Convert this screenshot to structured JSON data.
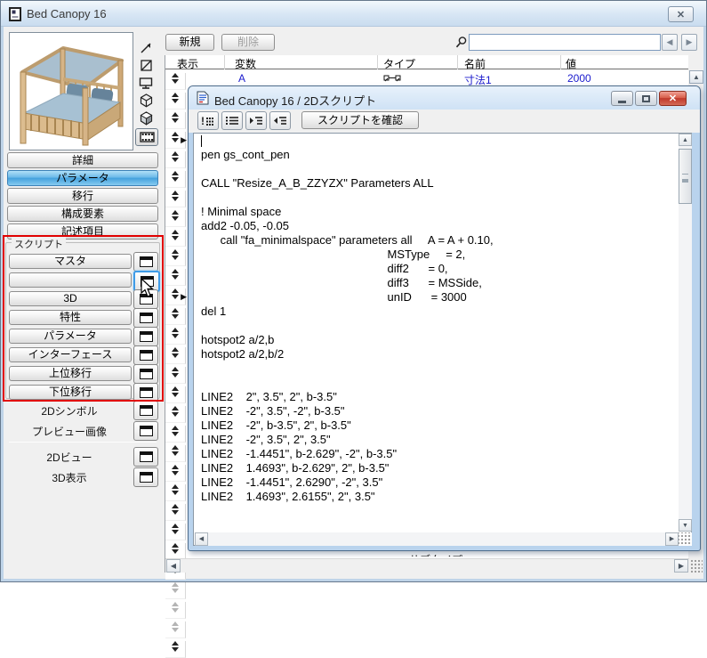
{
  "window": {
    "title": "Bed Canopy 16",
    "close_glyph": "✕"
  },
  "toolbar": {
    "new_label": "新規",
    "delete_label": "削除"
  },
  "search": {
    "value": "",
    "prev_glyph": "◀",
    "next_glyph": "▶"
  },
  "param_table": {
    "headers": [
      "表示",
      "変数",
      "タイプ",
      "名前",
      "値"
    ],
    "first_row": {
      "variable": "A",
      "type_icon": "dimension-type-icon",
      "name": "寸法1",
      "value": "2000"
    },
    "scroll_up_glyph": "▲"
  },
  "param_strip": {
    "row_count": 30,
    "arrow_rows": [
      3,
      11
    ],
    "light_rows": [
      26,
      27,
      28
    ],
    "row_arrow_glyph": "▶"
  },
  "left_panel": {
    "preview_image": "bed-canopy-photo",
    "preview_icons": [
      "2d-symbol-icon",
      "no-preview-icon",
      "monitor-icon",
      "wireframe-cube-icon",
      "shaded-cube-icon",
      "film-icon"
    ],
    "preview_selected_index": 5,
    "nav_buttons": [
      {
        "label": "詳細",
        "selected": false
      },
      {
        "label": "パラメータ",
        "selected": true
      },
      {
        "label": "移行",
        "selected": false
      },
      {
        "label": "構成要素",
        "selected": false
      },
      {
        "label": "記述項目",
        "selected": false
      }
    ],
    "script_group_label": "スクリプト",
    "script_rows": [
      {
        "label": "マスタ",
        "focused": false
      },
      {
        "label": "",
        "focused": true
      },
      {
        "label": "3D",
        "focused": false
      },
      {
        "label": "特性",
        "focused": false
      },
      {
        "label": "パラメータ",
        "focused": false
      },
      {
        "label": "インターフェース",
        "focused": false
      },
      {
        "label": "上位移行",
        "focused": false
      },
      {
        "label": "下位移行",
        "focused": false
      }
    ],
    "symbol_items": [
      {
        "label": "2Dシンボル"
      },
      {
        "label": "プレビュー画像"
      }
    ],
    "view_items": [
      {
        "label": "2Dビュー"
      },
      {
        "label": "3D表示"
      }
    ]
  },
  "script_window": {
    "title": "Bed Canopy 16 / 2Dスクリプト",
    "controls": {
      "close_glyph": "✕"
    },
    "toolbar": {
      "icon_buttons": [
        "check-script-icon",
        "line-numbers-icon",
        "indent-icon",
        "outdent-icon"
      ],
      "check_label": "スクリプトを確認"
    },
    "code_lines": [
      "",
      "pen gs_cont_pen",
      "",
      "CALL \"Resize_A_B_ZZYZX\" Parameters ALL",
      "",
      "! Minimal space",
      "add2 -0.05, -0.05",
      "      call \"fa_minimalspace\" parameters all     A = A + 0.10,",
      "                                                          MSType     = 2,",
      "                                                          diff2      = 0,",
      "                                                          diff3      = MSSide,",
      "                                                          unID      = 3000",
      "del 1",
      "",
      "hotspot2 a/2,b",
      "hotspot2 a/2,b/2",
      "",
      "",
      "LINE2    2\", 3.5\", 2\", b-3.5\"",
      "LINE2    -2\", 3.5\", -2\", b-3.5\"",
      "LINE2    -2\", b-3.5\", 2\", b-3.5\"",
      "LINE2    -2\", 3.5\", 2\", 3.5\"",
      "LINE2    -1.4451\", b-2.629\", -2\", b-3.5\"",
      "LINE2    1.4693\", b-2.629\", 2\", b-3.5\"",
      "LINE2    -1.4451\", 2.6290\", -2\", 3.5\"",
      "LINE2    1.4693\", 2.6155\", 2\", 3.5\""
    ],
    "scroll_glyphs": {
      "up": "▲",
      "down": "▼",
      "left": "◀",
      "right": "▶"
    }
  },
  "clipped_fragment_text": "サブタイプ",
  "colors": {
    "annotation_red": "#e10000",
    "selected_button_blue": "#43a0dd",
    "link_blue": "#1a1acd",
    "close_red": "#c0392b",
    "frame_blue": "#bfd4e8"
  }
}
